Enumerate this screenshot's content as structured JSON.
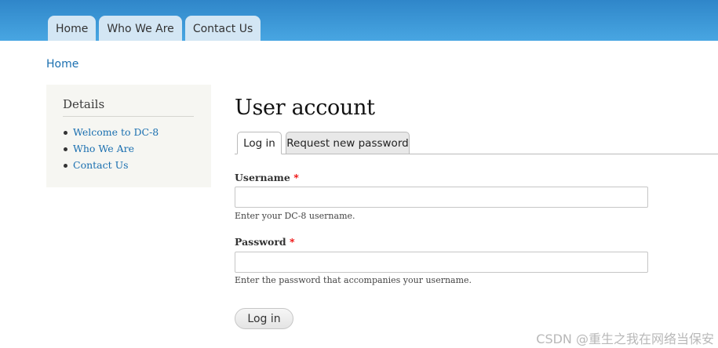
{
  "header": {
    "menu": [
      "Home",
      "Who We Are",
      "Contact Us"
    ]
  },
  "breadcrumb": "Home",
  "sidebar": {
    "title": "Details",
    "links": [
      "Welcome to DC-8",
      "Who We Are",
      "Contact Us"
    ]
  },
  "page": {
    "title": "User account",
    "tabs": [
      "Log in",
      "Request new password"
    ],
    "username": {
      "label": "Username",
      "required_mark": "*",
      "value": "",
      "description": "Enter your DC-8 username."
    },
    "password": {
      "label": "Password",
      "required_mark": "*",
      "value": "",
      "description": "Enter the password that accompanies your username."
    },
    "submit_label": "Log in"
  },
  "watermark": "CSDN @重生之我在网络当保安"
}
